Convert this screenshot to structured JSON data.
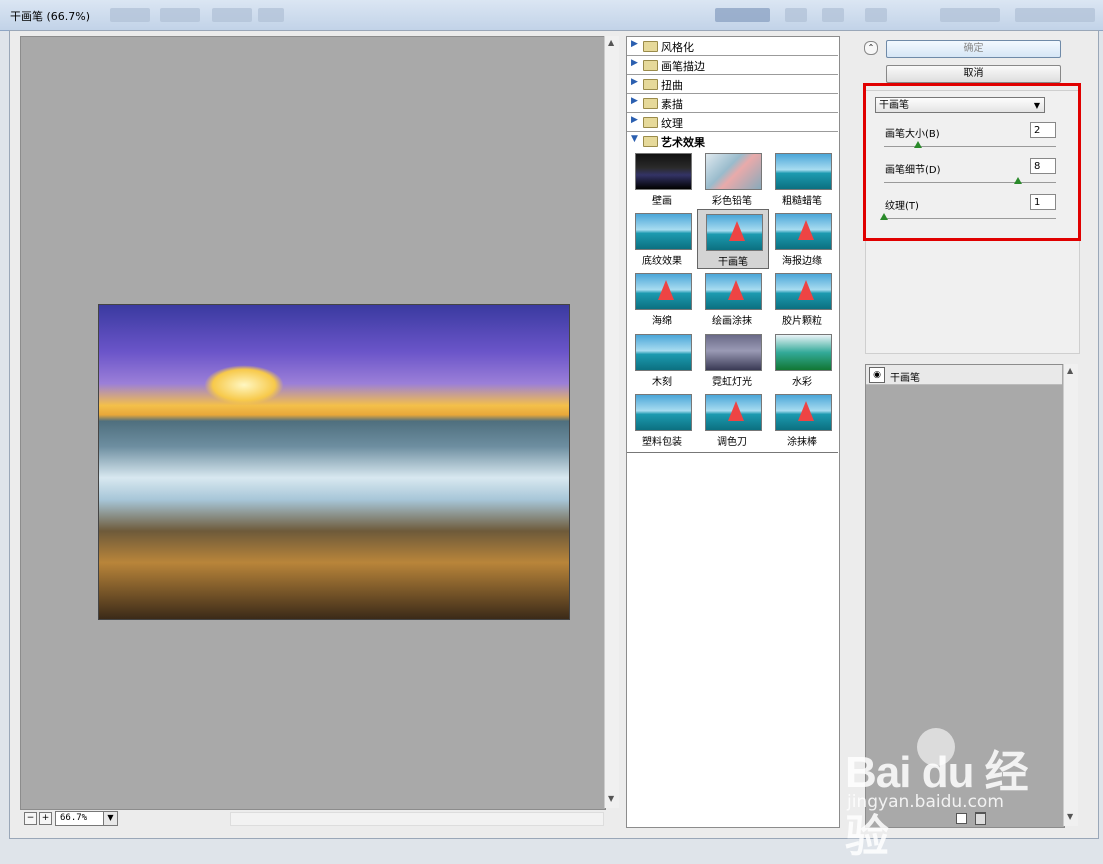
{
  "window": {
    "title": "干画笔 (66.7%)"
  },
  "zoom": {
    "value": "66.7%"
  },
  "categories": [
    {
      "label": "风格化",
      "open": false
    },
    {
      "label": "画笔描边",
      "open": false
    },
    {
      "label": "扭曲",
      "open": false
    },
    {
      "label": "素描",
      "open": false
    },
    {
      "label": "纹理",
      "open": false
    },
    {
      "label": "艺术效果",
      "open": true
    }
  ],
  "thumbnails": [
    {
      "label": "壁画"
    },
    {
      "label": "彩色铅笔"
    },
    {
      "label": "粗糙蜡笔"
    },
    {
      "label": "底纹效果"
    },
    {
      "label": "干画笔",
      "selected": true
    },
    {
      "label": "海报边缘"
    },
    {
      "label": "海绵"
    },
    {
      "label": "绘画涂抹"
    },
    {
      "label": "胶片颗粒"
    },
    {
      "label": "木刻"
    },
    {
      "label": "霓虹灯光"
    },
    {
      "label": "水彩"
    },
    {
      "label": "塑料包装"
    },
    {
      "label": "调色刀"
    },
    {
      "label": "涂抹棒"
    }
  ],
  "buttons": {
    "ok": "确定",
    "cancel": "取消"
  },
  "filter_select": {
    "value": "干画笔"
  },
  "params": [
    {
      "label": "画笔大小(B)",
      "value": "2",
      "level": 0.2
    },
    {
      "label": "画笔细节(D)",
      "value": "8",
      "level": 0.8
    },
    {
      "label": "纹理(T)",
      "value": "1",
      "level": 0.0
    }
  ],
  "layers": [
    {
      "name": "干画笔"
    }
  ],
  "watermark": {
    "logo": "Bai du 经验",
    "url": "jingyan.baidu.com"
  },
  "colors": {
    "highlight_box": "#e00000",
    "preview_bg": "#a9a9a9"
  }
}
